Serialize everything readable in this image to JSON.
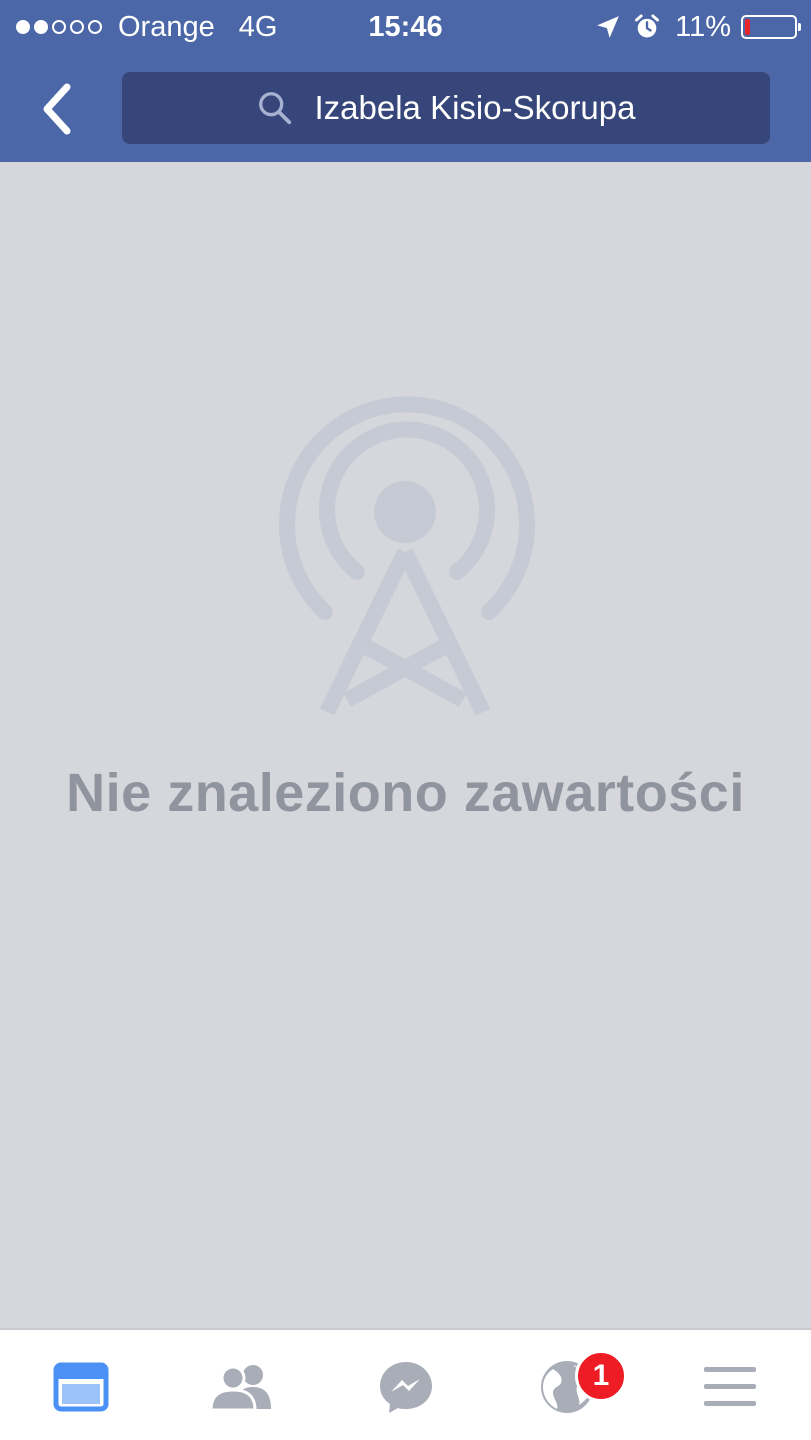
{
  "status_bar": {
    "signal_dots_filled": 2,
    "signal_dots_total": 5,
    "carrier": "Orange",
    "network": "4G",
    "time": "15:46",
    "battery_percent": "11%",
    "icons": [
      "location-arrow-icon",
      "alarm-icon",
      "battery-icon"
    ]
  },
  "header": {
    "back_icon": "chevron-left-icon",
    "search_icon": "search-icon",
    "search_query": "Izabela Kisio-Skorupa"
  },
  "empty_state": {
    "icon": "broadcast-tower-icon",
    "message": "Nie znaleziono zawartości"
  },
  "tab_bar": {
    "tabs": [
      {
        "name": "news-feed",
        "icon": "news-feed-icon",
        "active": true
      },
      {
        "name": "friend-requests",
        "icon": "friends-icon",
        "active": false
      },
      {
        "name": "messenger",
        "icon": "messenger-icon",
        "active": false
      },
      {
        "name": "notifications",
        "icon": "globe-icon",
        "active": false,
        "badge": "1"
      },
      {
        "name": "more",
        "icon": "menu-icon",
        "active": false
      }
    ]
  },
  "colors": {
    "header_bg": "#4b67a7",
    "search_bg": "#36467a",
    "page_bg": "#d6d7dc",
    "active_tab": "#4a90f5",
    "inactive_tab": "#a9adb8",
    "badge": "#ee1c25",
    "battery_low": "#e5242b"
  }
}
